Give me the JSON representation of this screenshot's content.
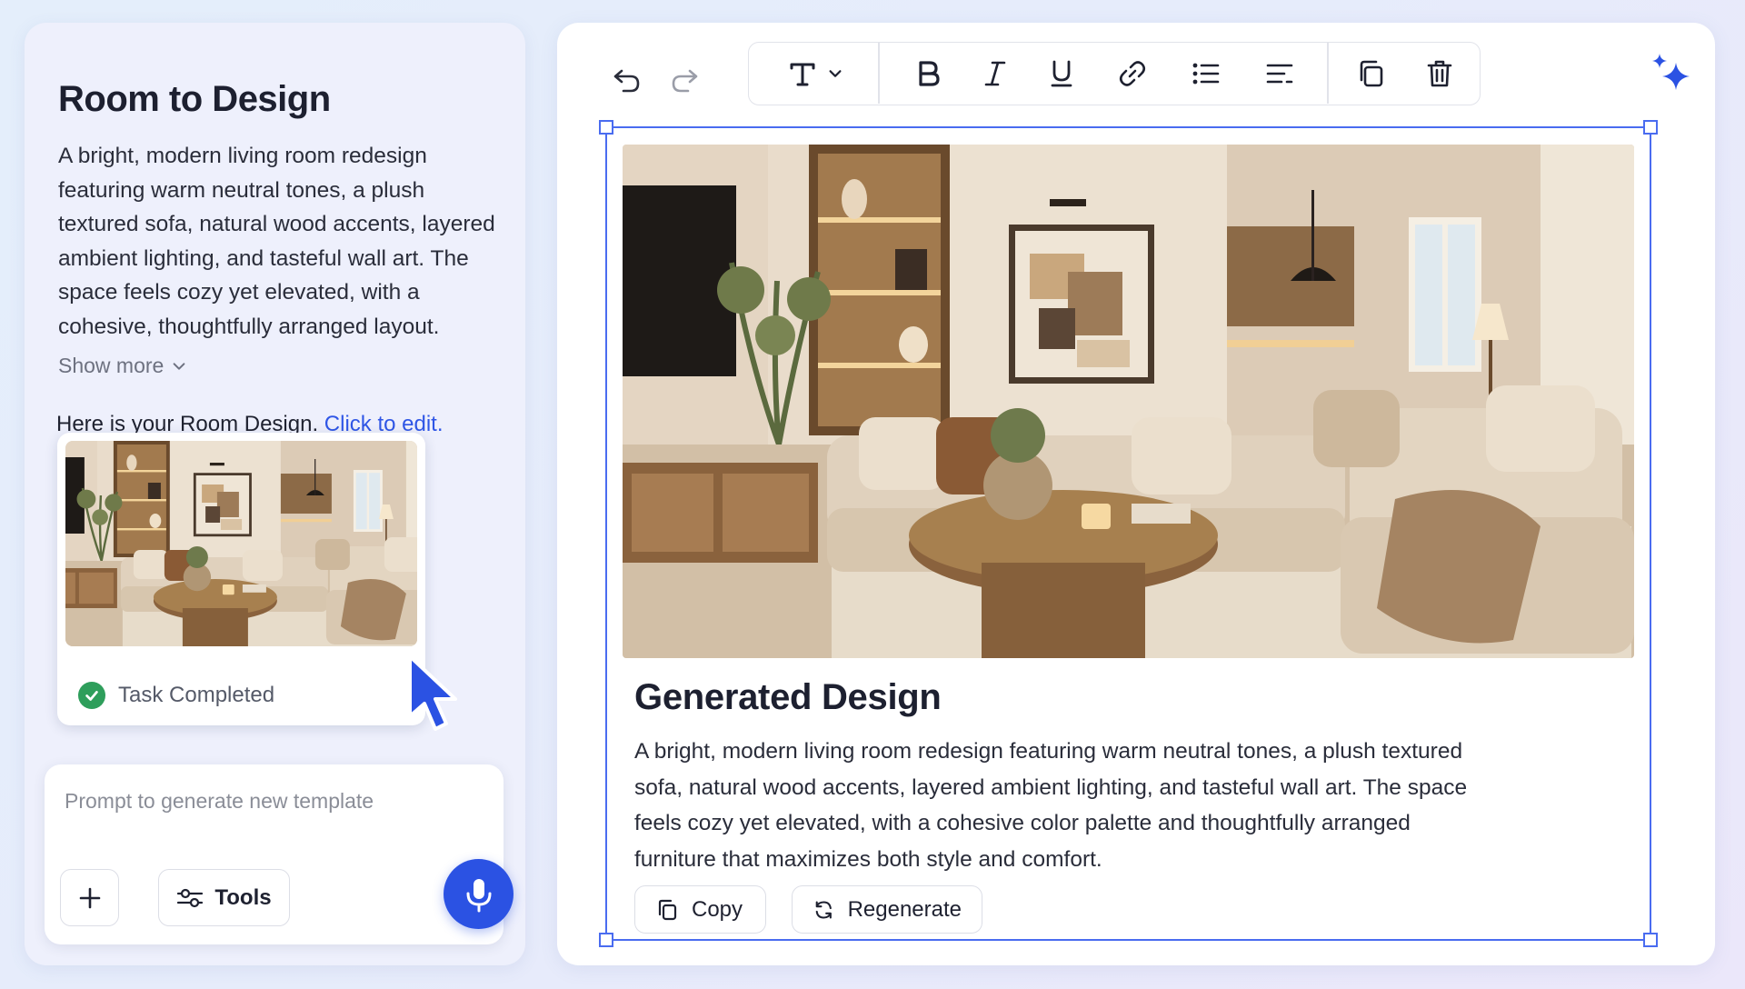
{
  "left_panel": {
    "title": "Room to Design",
    "description": "A bright, modern living room redesign featuring warm neutral tones, a plush textured sofa, natural wood accents, layered ambient lighting, and tasteful wall art. The space feels cozy yet elevated, with a cohesive, thoughtfully arranged layout.",
    "show_more_label": "Show more",
    "result_text": "Here is your Room Design.",
    "edit_link": "Click to edit.",
    "task_status": "Task Completed"
  },
  "prompt": {
    "placeholder": "Prompt to generate new template",
    "value": "",
    "tools_label": "Tools"
  },
  "editor": {
    "title": "Generated Design",
    "description": "A bright, modern living room redesign featuring warm neutral tones, a plush textured sofa, natural wood accents, layered ambient lighting, and tasteful wall art. The space feels cozy yet elevated, with a cohesive color palette and thoughtfully arranged furniture that maximizes both style and comfort.",
    "copy_label": "Copy",
    "regenerate_label": "Regenerate"
  },
  "icons": {
    "undo": "undo-icon",
    "redo": "redo-icon",
    "text": "text-style-icon",
    "bold": "bold-icon",
    "italic": "italic-icon",
    "underline": "underline-icon",
    "link": "link-icon",
    "list": "bulleted-list-icon",
    "align": "align-left-icon",
    "duplicate": "duplicate-icon",
    "delete": "trash-icon",
    "ai": "sparkle-icon",
    "microphone": "microphone-icon",
    "plus": "plus-icon",
    "tools": "sliders-icon"
  },
  "colors": {
    "accent": "#2b52e3",
    "selection": "#4a6cf0",
    "link": "#2f56e6",
    "success": "#2e9e5b"
  }
}
